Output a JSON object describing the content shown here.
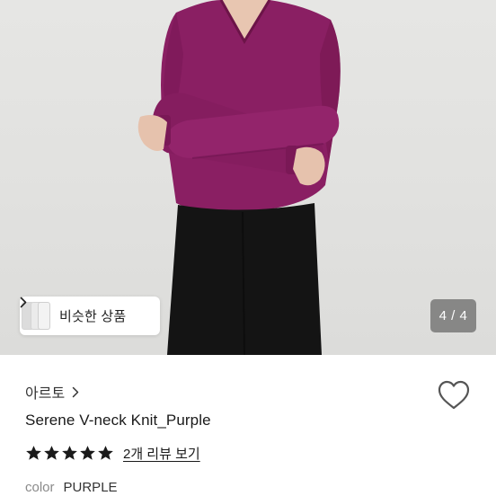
{
  "gallery": {
    "similar_label": "비슷한 상품",
    "page_counter": "4 / 4"
  },
  "product": {
    "store_name": "아르토",
    "title": "Serene V-neck Knit_Purple",
    "rating_stars": 5,
    "review_link": "2개 리뷰 보기",
    "option_key": "color",
    "option_value": "PURPLE"
  },
  "colors": {
    "sweater": "#8a1f63",
    "skirt": "#141414",
    "star": "#1a1a1a"
  },
  "icons": [
    "chevron-right-icon",
    "heart-outline-icon",
    "star-icon"
  ]
}
